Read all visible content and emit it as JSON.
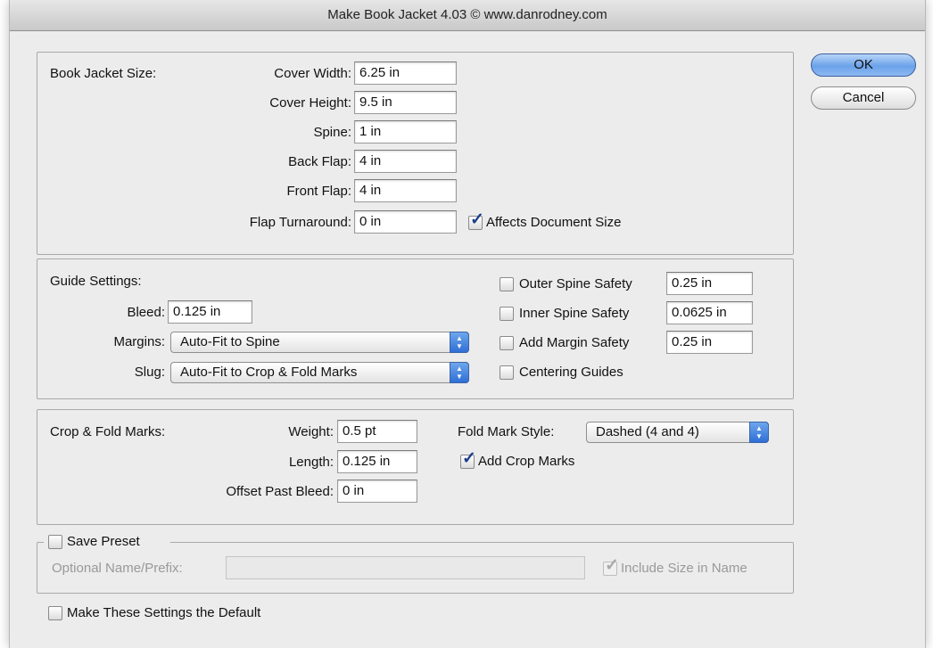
{
  "window": {
    "title": "Make Book Jacket 4.03 © www.danrodney.com"
  },
  "buttons": {
    "ok": "OK",
    "cancel": "Cancel"
  },
  "jacket": {
    "heading": "Book Jacket Size:",
    "cover_width_label": "Cover Width:",
    "cover_width": "6.25 in",
    "cover_height_label": "Cover Height:",
    "cover_height": "9.5 in",
    "spine_label": "Spine:",
    "spine": "1 in",
    "back_flap_label": "Back Flap:",
    "back_flap": "4 in",
    "front_flap_label": "Front Flap:",
    "front_flap": "4 in",
    "flap_turnaround_label": "Flap Turnaround:",
    "flap_turnaround": "0 in",
    "affects_doc_label": "Affects Document Size",
    "affects_doc_checked": true
  },
  "guides": {
    "heading": "Guide Settings:",
    "bleed_label": "Bleed:",
    "bleed": "0.125 in",
    "margins_label": "Margins:",
    "margins_value": "Auto-Fit to Spine",
    "slug_label": "Slug:",
    "slug_value": "Auto-Fit to Crop & Fold Marks",
    "outer_spine_label": "Outer Spine Safety",
    "outer_spine": "0.25 in",
    "outer_spine_checked": false,
    "inner_spine_label": "Inner Spine Safety",
    "inner_spine": "0.0625 in",
    "inner_spine_checked": false,
    "add_margin_label": "Add Margin Safety",
    "add_margin": "0.25 in",
    "add_margin_checked": false,
    "centering_label": "Centering Guides",
    "centering_checked": false
  },
  "marks": {
    "heading": "Crop & Fold Marks:",
    "weight_label": "Weight:",
    "weight": "0.5 pt",
    "length_label": "Length:",
    "length": "0.125 in",
    "offset_label": "Offset Past Bleed:",
    "offset": "0 in",
    "fold_style_label": "Fold Mark Style:",
    "fold_style_value": "Dashed (4 and 4)",
    "add_crop_label": "Add Crop Marks",
    "add_crop_checked": true
  },
  "preset": {
    "save_label": "Save Preset",
    "save_checked": false,
    "name_label": "Optional Name/Prefix:",
    "name_value": "",
    "include_size_label": "Include Size in Name",
    "include_size_checked": true
  },
  "default": {
    "label": "Make These Settings the Default",
    "checked": false
  }
}
